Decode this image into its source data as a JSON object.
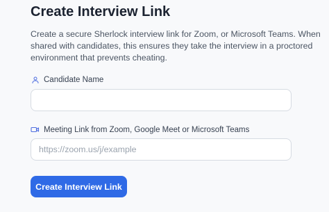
{
  "form": {
    "title": "Create Interview Link",
    "description": "Create a secure Sherlock interview link for Zoom, or Microsoft Teams. When shared with candidates, this ensures they take the interview in a proctored environment that prevents cheating.",
    "candidate_name": {
      "label": "Candidate Name",
      "icon": "user-icon",
      "value": "",
      "placeholder": ""
    },
    "meeting_link": {
      "label": "Meeting Link from Zoom, Google Meet or Microsoft Teams",
      "icon": "video-camera-icon",
      "value": "",
      "placeholder": "https://zoom.us/j/example"
    },
    "submit_label": "Create Interview Link"
  },
  "colors": {
    "accent": "#2f6ae6",
    "icon": "#4f6ee0",
    "background": "#f8f9fb"
  }
}
